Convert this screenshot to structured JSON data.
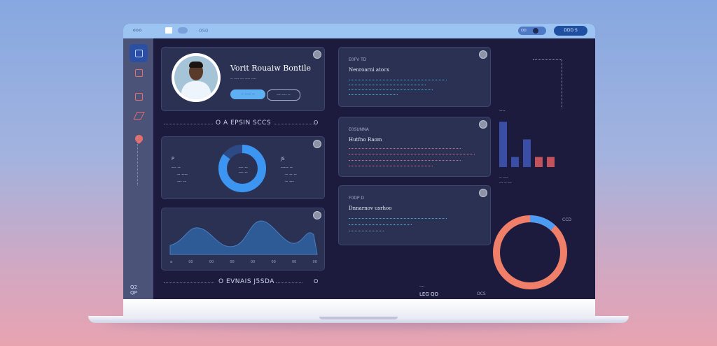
{
  "topbar": {
    "title": "ooo",
    "window_icon": "window-icon",
    "cloud_icon": "cloud-icon",
    "text": "0S0",
    "toggle_label": "OD",
    "button_label": "DDD S"
  },
  "sidebar": {
    "items": [
      {
        "icon": "home-icon"
      },
      {
        "icon": "calendar-icon"
      },
      {
        "icon": "file-icon"
      },
      {
        "icon": "chart-icon"
      },
      {
        "icon": "heart-icon"
      }
    ],
    "footer": "Q2\nQP"
  },
  "profile": {
    "name": "Vorit Rouaiw Bontile",
    "subtitle": "-- ---- --- ---- ----",
    "primary_button": "-- ----- --",
    "secondary_button": "--- ---- --"
  },
  "dividers": [
    {
      "text": "O A EPSIN SCCS",
      "end": "O"
    },
    {
      "text": "O EVNAIS J5SDA",
      "end": "O"
    }
  ],
  "donut_card": {
    "left_labels": [
      "P",
      "--- --",
      "-- ----",
      "--- --"
    ],
    "right_labels": [
      "JS",
      "----- --",
      "-- -- --",
      "-- ---"
    ],
    "center_text": "--- --\n--- --"
  },
  "wave_card": {
    "x_ticks": [
      "a",
      "00",
      "00",
      "00",
      "00",
      "00",
      "00",
      "00"
    ]
  },
  "info_cards": [
    {
      "label": "E0FV TD",
      "title": "Nenroarni atocx",
      "lines": 4
    },
    {
      "label": "E0SUNNA",
      "title": "Hutfno Raom",
      "lines": 4
    },
    {
      "label": "F0DP D",
      "title": "Dnnarnov usrhoo",
      "lines": 4
    }
  ],
  "bar_chart": {
    "label": "----",
    "values": [
      0.9,
      0.2,
      0.55,
      0.2,
      0.2
    ],
    "colors": [
      "#3b4ea5",
      "#3b4ea5",
      "#3b4ea5",
      "#c2535b",
      "#c2535b"
    ],
    "legend": [
      "-- ----",
      "--- -- ---"
    ]
  },
  "ring_chart": {
    "blue_fraction": 0.12,
    "blue_color": "#4c9cf3",
    "orange_color": "#ef7f69",
    "label_right": "CCD",
    "label_left": "OCS",
    "note_title": "----",
    "note_text": "LEG QO"
  }
}
